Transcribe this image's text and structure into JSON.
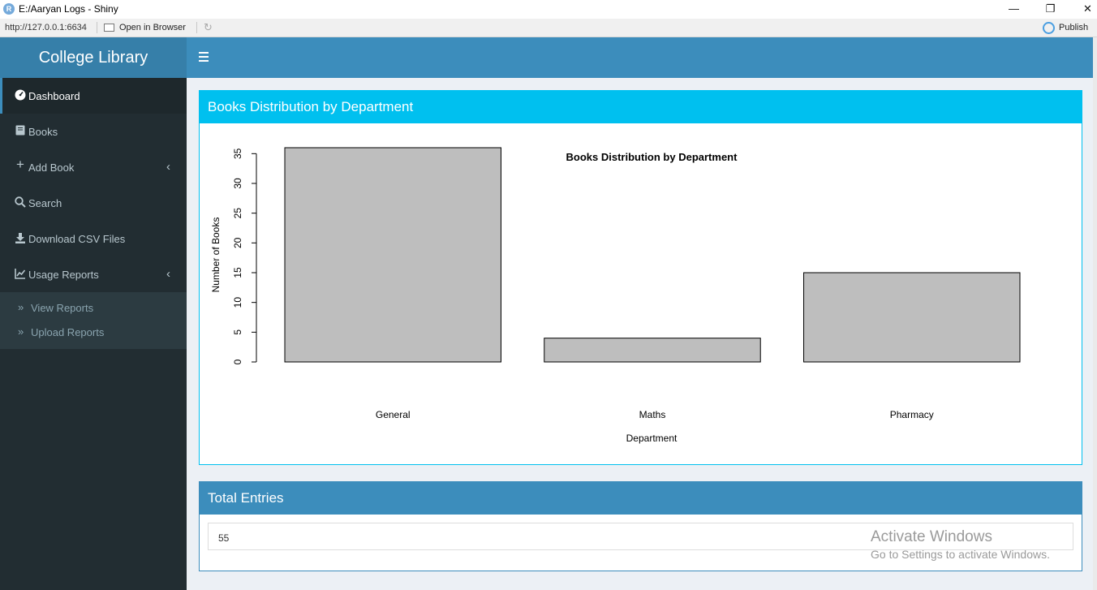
{
  "window": {
    "app_icon_letter": "R",
    "title": "E:/Aaryan Logs - Shiny",
    "minimize": "—",
    "maximize": "❐",
    "close": "✕"
  },
  "toolbar": {
    "url": "http://127.0.0.1:6634",
    "open_label": "Open in Browser",
    "publish_label": "Publish"
  },
  "sidebar": {
    "brand": "College Library",
    "items": [
      {
        "label": "Dashboard",
        "icon": "tachometer-icon",
        "active": true
      },
      {
        "label": "Books",
        "icon": "book-icon"
      },
      {
        "label": "Add Book",
        "icon": "plus-icon",
        "chevron": "left"
      },
      {
        "label": "Search",
        "icon": "search-icon"
      },
      {
        "label": "Download CSV Files",
        "icon": "download-icon"
      },
      {
        "label": "Usage Reports",
        "icon": "line-chart-icon",
        "chevron": "left"
      }
    ],
    "subitems": [
      {
        "label": "View Reports",
        "icon": "double-chevron-right-icon"
      },
      {
        "label": "Upload Reports",
        "icon": "double-chevron-right-icon"
      }
    ]
  },
  "chart_box": {
    "title": "Books Distribution by Department"
  },
  "chart_data": {
    "type": "bar",
    "title": "Books Distribution by Department",
    "xlabel": "Department",
    "ylabel": "Number of Books",
    "categories": [
      "General",
      "Maths",
      "Pharmacy"
    ],
    "values": [
      36,
      4,
      15
    ],
    "ylim": [
      0,
      36
    ],
    "yticks": [
      0,
      5,
      10,
      15,
      20,
      25,
      30,
      35
    ],
    "bar_color": "#bebebe",
    "grid": false
  },
  "total_box": {
    "title": "Total Entries",
    "value": "55"
  },
  "watermark": {
    "line1": "Activate Windows",
    "line2": "Go to Settings to activate Windows."
  },
  "colors": {
    "header": "#3c8dbc",
    "logo": "#367fa9",
    "sidebar": "#222d32",
    "chart_box": "#00c0ef"
  }
}
